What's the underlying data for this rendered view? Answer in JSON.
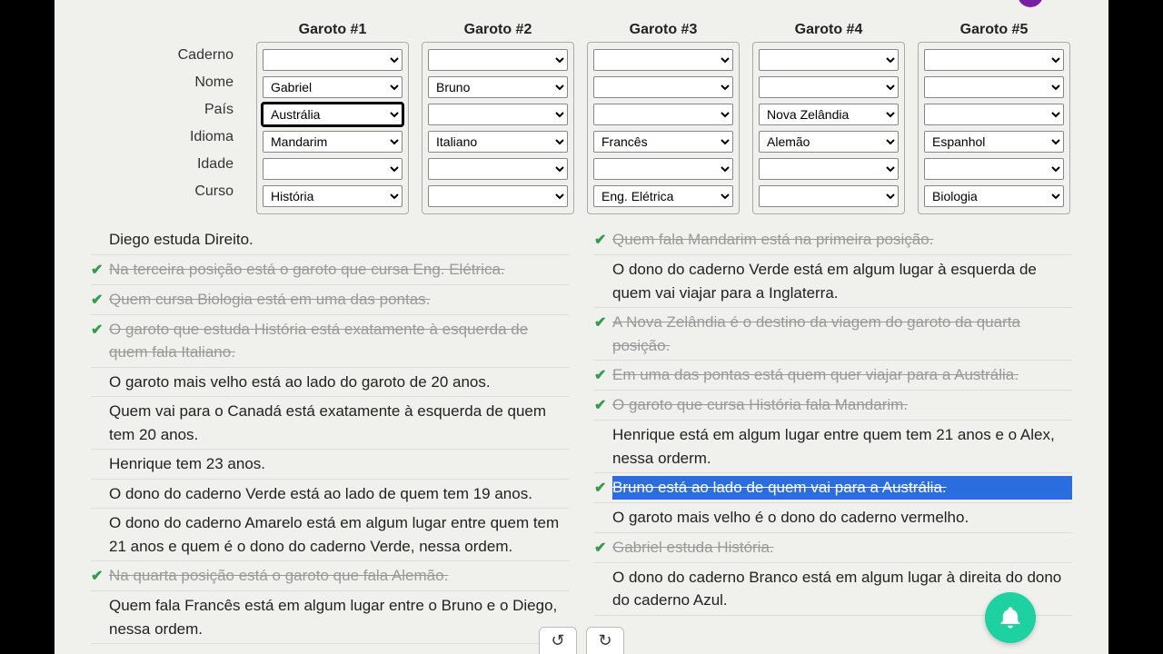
{
  "headers": [
    "Garoto #1",
    "Garoto #2",
    "Garoto #3",
    "Garoto #4",
    "Garoto #5"
  ],
  "row_labels": [
    "Caderno",
    "Nome",
    "País",
    "Idioma",
    "Idade",
    "Curso"
  ],
  "grid": {
    "g1": {
      "caderno": "",
      "nome": "Gabriel",
      "pais": "Austrália",
      "idioma": "Mandarim",
      "idade": "",
      "curso": "História"
    },
    "g2": {
      "caderno": "",
      "nome": "Bruno",
      "pais": "",
      "idioma": "Italiano",
      "idade": "",
      "curso": ""
    },
    "g3": {
      "caderno": "",
      "nome": "",
      "pais": "",
      "idioma": "Francês",
      "idade": "",
      "curso": "Eng. Elétrica"
    },
    "g4": {
      "caderno": "",
      "nome": "",
      "pais": "Nova Zelândia",
      "idioma": "Alemão",
      "idade": "",
      "curso": ""
    },
    "g5": {
      "caderno": "",
      "nome": "",
      "pais": "",
      "idioma": "Espanhol",
      "idade": "",
      "curso": "Biologia"
    }
  },
  "clues_left": [
    {
      "done": false,
      "text": "Diego estuda Direito."
    },
    {
      "done": true,
      "text": "Na terceira posição está o garoto que cursa Eng. Elétrica."
    },
    {
      "done": true,
      "text": "Quem cursa Biologia está em uma das pontas."
    },
    {
      "done": true,
      "text": "O garoto que estuda História está exatamente à esquerda de quem fala Italiano."
    },
    {
      "done": false,
      "text": "O garoto mais velho está ao lado do garoto de 20 anos."
    },
    {
      "done": false,
      "text": "Quem vai para o Canadá está exatamente à esquerda de quem tem 20 anos."
    },
    {
      "done": false,
      "text": "Henrique tem 23 anos."
    },
    {
      "done": false,
      "text": "O dono do caderno Verde está ao lado de quem tem 19 anos."
    },
    {
      "done": false,
      "text": "O dono do caderno Amarelo está em algum lugar entre quem tem 21 anos e quem é o dono do caderno Verde, nessa ordem."
    },
    {
      "done": true,
      "text": "Na quarta posição está o garoto que fala Alemão."
    },
    {
      "done": false,
      "text": "Quem fala Francês está em algum lugar entre o Bruno e o Diego, nessa ordem."
    }
  ],
  "clues_right": [
    {
      "done": true,
      "text": "Quem fala Mandarim está na primeira posição."
    },
    {
      "done": false,
      "text": "O dono do caderno Verde está em algum lugar à esquerda de quem vai viajar para a Inglaterra."
    },
    {
      "done": true,
      "text": "A Nova Zelândia é o destino da viagem do garoto da quarta posição."
    },
    {
      "done": true,
      "text": "Em uma das pontas está quem quer viajar para a Austrália."
    },
    {
      "done": true,
      "text": "O garoto que cursa História fala Mandarim."
    },
    {
      "done": false,
      "text": "Henrique está em algum lugar entre quem tem 21 anos e o Alex, nessa orderm."
    },
    {
      "done": true,
      "selected": true,
      "text": "Bruno está ao lado de quem vai para a Austrália."
    },
    {
      "done": false,
      "text": "O garoto mais velho é o dono do caderno vermelho."
    },
    {
      "done": true,
      "text": "Gabriel estuda História."
    },
    {
      "done": false,
      "text": "O dono do caderno Branco está em algum lugar à direita do dono do caderno Azul."
    }
  ],
  "controls": {
    "undo": "↺",
    "redo": "↻"
  }
}
